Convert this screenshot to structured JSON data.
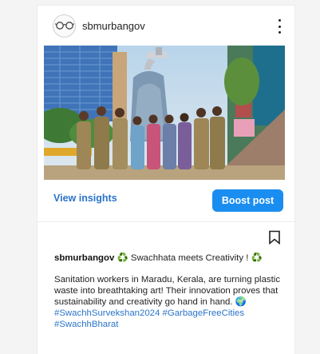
{
  "post": {
    "username": "sbmurbangov",
    "image_alt": "Sanitation workers posing in front of a large tap sculpture made of plastic bottles",
    "actions": {
      "insights_label": "View insights",
      "boost_label": "Boost post"
    },
    "caption": {
      "username": "sbmurbangov",
      "headline": "♻️ Swachhata meets Creativity ! ♻️",
      "body": "Sanitation workers in Maradu, Kerala, are turning plastic waste into breathtaking art! Their innovation proves that sustainability and creativity go hand in hand. 🌍",
      "hashtags": "#SwachhSurvekshan2024 #GarbageFreeCities #SwachhBharat"
    },
    "icons": {
      "avatar": "sbm-logo-glasses",
      "more": "more-vertical-icon",
      "bookmark": "bookmark-icon"
    },
    "colors": {
      "link": "#2a74c9",
      "button": "#1a8ef0"
    }
  }
}
